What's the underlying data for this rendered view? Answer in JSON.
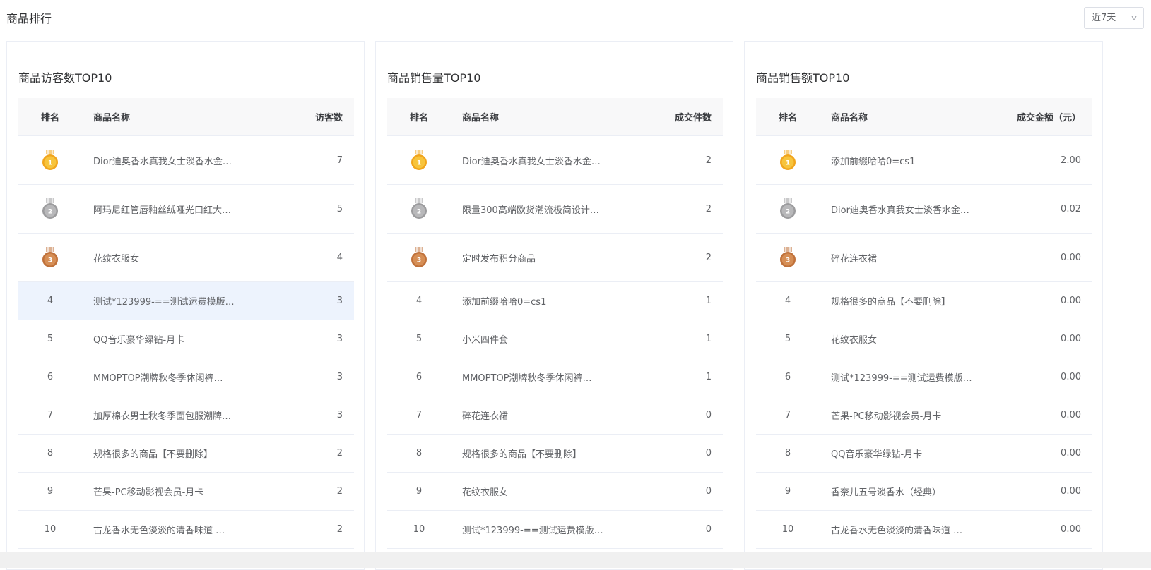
{
  "header": {
    "title": "商品排行",
    "range": "近7天"
  },
  "colors": {
    "gold": "#f7c43c",
    "silver": "#b3b3b5",
    "bronze": "#d68e55",
    "highlight_row": "#edf3fd"
  },
  "panels": [
    {
      "title": "商品访客数TOP10",
      "columns": {
        "rank": "排名",
        "name": "商品名称",
        "value": "访客数"
      },
      "rows": [
        {
          "rank": "1",
          "medal": "gold-medal-icon",
          "name": "Dior迪奥香水真我女士淡香水金…",
          "value": "7"
        },
        {
          "rank": "2",
          "medal": "silver-medal-icon",
          "name": "阿玛尼红管唇釉丝绒哑光口红大…",
          "value": "5"
        },
        {
          "rank": "3",
          "medal": "bronze-medal-icon",
          "name": "花纹衣服女",
          "value": "4"
        },
        {
          "rank": "4",
          "name": "测试*123999-==测试运费模版…",
          "value": "3",
          "highlight": true
        },
        {
          "rank": "5",
          "name": "QQ音乐豪华绿钻-月卡",
          "value": "3"
        },
        {
          "rank": "6",
          "name": "MMOPTOP潮牌秋冬季休闲裤…",
          "value": "3"
        },
        {
          "rank": "7",
          "name": "加厚棉衣男士秋冬季面包服潮牌…",
          "value": "3"
        },
        {
          "rank": "8",
          "name": "规格很多的商品【不要删除】",
          "value": "2"
        },
        {
          "rank": "9",
          "name": "芒果-PC移动影视会员-月卡",
          "value": "2"
        },
        {
          "rank": "10",
          "name": "古龙香水无色淡淡的清香味道 …",
          "value": "2"
        }
      ]
    },
    {
      "title": "商品销售量TOP10",
      "columns": {
        "rank": "排名",
        "name": "商品名称",
        "value": "成交件数"
      },
      "rows": [
        {
          "rank": "1",
          "medal": "gold-medal-icon",
          "name": "Dior迪奥香水真我女士淡香水金…",
          "value": "2"
        },
        {
          "rank": "2",
          "medal": "silver-medal-icon",
          "name": "限量300高端欧货潮流极简设计…",
          "value": "2"
        },
        {
          "rank": "3",
          "medal": "bronze-medal-icon",
          "name": "定时发布积分商品",
          "value": "2"
        },
        {
          "rank": "4",
          "name": "添加前缀哈哈0=cs1",
          "value": "1"
        },
        {
          "rank": "5",
          "name": "小米四件套",
          "value": "1"
        },
        {
          "rank": "6",
          "name": "MMOPTOP潮牌秋冬季休闲裤…",
          "value": "1"
        },
        {
          "rank": "7",
          "name": "碎花连衣裙",
          "value": "0"
        },
        {
          "rank": "8",
          "name": "规格很多的商品【不要删除】",
          "value": "0"
        },
        {
          "rank": "9",
          "name": "花纹衣服女",
          "value": "0"
        },
        {
          "rank": "10",
          "name": "测试*123999-==测试运费模版…",
          "value": "0"
        }
      ]
    },
    {
      "title": "商品销售额TOP10",
      "columns": {
        "rank": "排名",
        "name": "商品名称",
        "value": "成交金额（元）"
      },
      "rows": [
        {
          "rank": "1",
          "medal": "gold-medal-icon",
          "name": "添加前缀哈哈0=cs1",
          "value": "2.00"
        },
        {
          "rank": "2",
          "medal": "silver-medal-icon",
          "name": "Dior迪奥香水真我女士淡香水金…",
          "value": "0.02"
        },
        {
          "rank": "3",
          "medal": "bronze-medal-icon",
          "name": "碎花连衣裙",
          "value": "0.00"
        },
        {
          "rank": "4",
          "name": "规格很多的商品【不要删除】",
          "value": "0.00"
        },
        {
          "rank": "5",
          "name": "花纹衣服女",
          "value": "0.00"
        },
        {
          "rank": "6",
          "name": "测试*123999-==测试运费模版…",
          "value": "0.00"
        },
        {
          "rank": "7",
          "name": "芒果-PC移动影视会员-月卡",
          "value": "0.00"
        },
        {
          "rank": "8",
          "name": "QQ音乐豪华绿钻-月卡",
          "value": "0.00"
        },
        {
          "rank": "9",
          "name": "香奈儿五号淡香水（经典）",
          "value": "0.00"
        },
        {
          "rank": "10",
          "name": "古龙香水无色淡淡的清香味道 …",
          "value": "0.00"
        }
      ]
    }
  ]
}
